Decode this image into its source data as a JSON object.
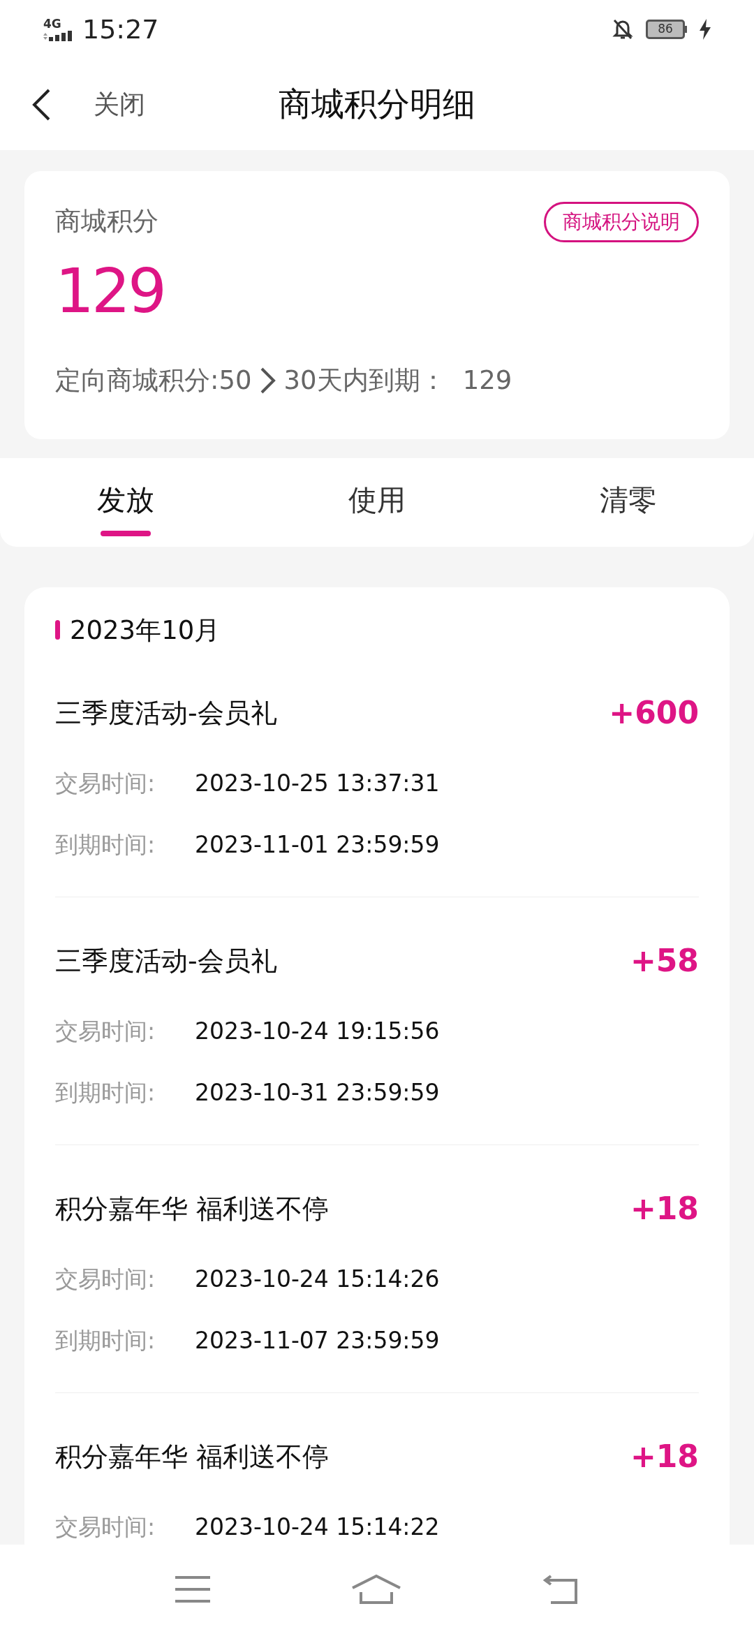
{
  "status_bar": {
    "network": "4G",
    "time": "15:27",
    "battery": "86"
  },
  "header": {
    "close": "关闭",
    "title": "商城积分明细"
  },
  "summary": {
    "label": "商城积分",
    "explain_button": "商城积分说明",
    "points": "129",
    "directed": "定向商城积分:50",
    "expiring_label": "30天内到期：",
    "expiring_value": "129"
  },
  "tabs": [
    {
      "label": "发放",
      "selected": true
    },
    {
      "label": "使用",
      "selected": false
    },
    {
      "label": "清零",
      "selected": false
    }
  ],
  "month": "2023年10月",
  "records": [
    {
      "title": "三季度活动-会员礼",
      "amount": "+600",
      "trade_label": "交易时间:",
      "trade_time": "2023-10-25 13:37:31",
      "expire_label": "到期时间:",
      "expire_time": "2023-11-01 23:59:59"
    },
    {
      "title": "三季度活动-会员礼",
      "amount": "+58",
      "trade_label": "交易时间:",
      "trade_time": "2023-10-24 19:15:56",
      "expire_label": "到期时间:",
      "expire_time": "2023-10-31 23:59:59"
    },
    {
      "title": "积分嘉年华 福利送不停",
      "amount": "+18",
      "trade_label": "交易时间:",
      "trade_time": "2023-10-24 15:14:26",
      "expire_label": "到期时间:",
      "expire_time": "2023-11-07 23:59:59"
    },
    {
      "title": "积分嘉年华 福利送不停",
      "amount": "+18",
      "trade_label": "交易时间:",
      "trade_time": "2023-10-24 15:14:22"
    }
  ]
}
